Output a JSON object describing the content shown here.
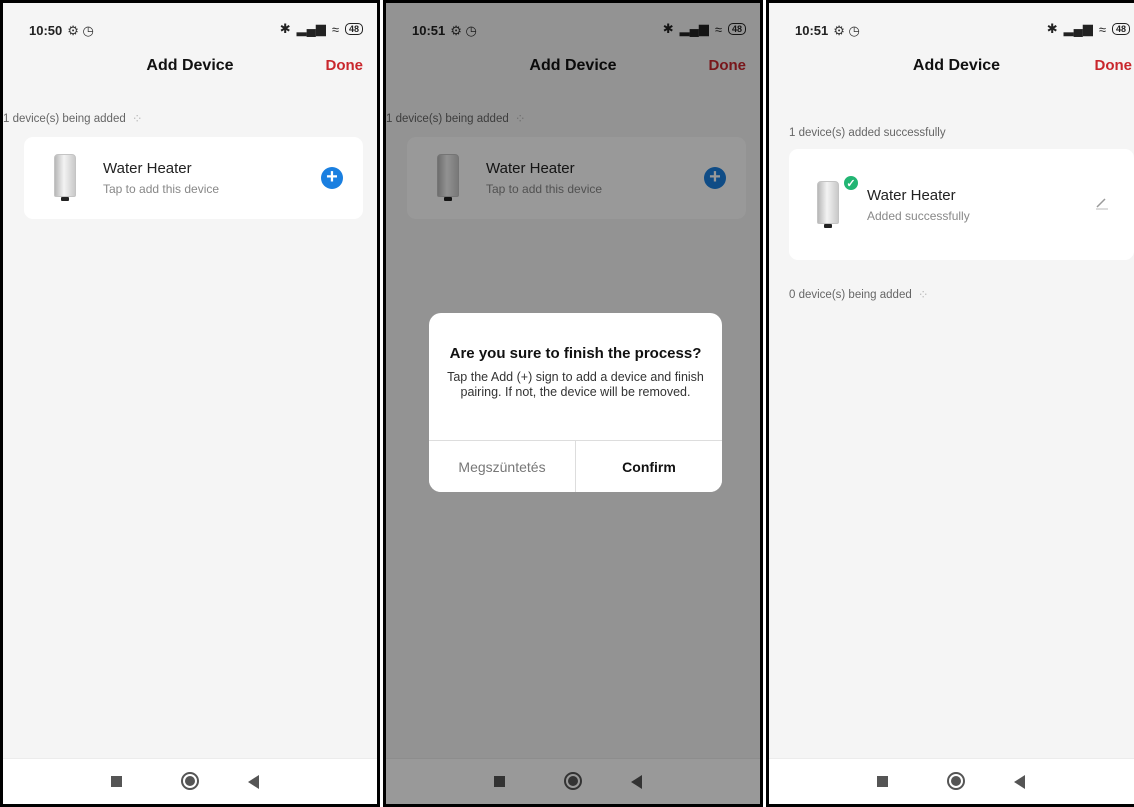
{
  "screen1": {
    "time": "10:50",
    "battery": "48",
    "title": "Add Device",
    "done": "Done",
    "being_added": "1 device(s) being added",
    "device": {
      "name": "Water Heater",
      "subtitle": "Tap to add this device"
    }
  },
  "screen2": {
    "time": "10:51",
    "battery": "48",
    "title": "Add Device",
    "done": "Done",
    "being_added": "1 device(s) being added",
    "device": {
      "name": "Water Heater",
      "subtitle": "Tap to add this device"
    },
    "dialog": {
      "title": "Are you sure to finish the process?",
      "message": "Tap the Add (+) sign to add a device and finish pairing. If not, the device will be removed.",
      "cancel": "Megszüntetés",
      "confirm": "Confirm"
    }
  },
  "screen3": {
    "time": "10:51",
    "battery": "48",
    "title": "Add Device",
    "done": "Done",
    "added_success": "1 device(s) added successfully",
    "device": {
      "name": "Water Heater",
      "subtitle": "Added successfully"
    },
    "being_added": "0 device(s) being added"
  },
  "colors": {
    "accent_red": "#c9272d",
    "add_blue": "#1a7fe0",
    "success_green": "#22b573"
  },
  "icons": [
    "bluetooth-icon",
    "signal-icon",
    "wifi-icon",
    "battery-icon",
    "alarm-icon",
    "add-circle-icon",
    "check-icon",
    "pencil-icon",
    "nav-square-icon",
    "nav-home-icon",
    "nav-back-icon"
  ]
}
